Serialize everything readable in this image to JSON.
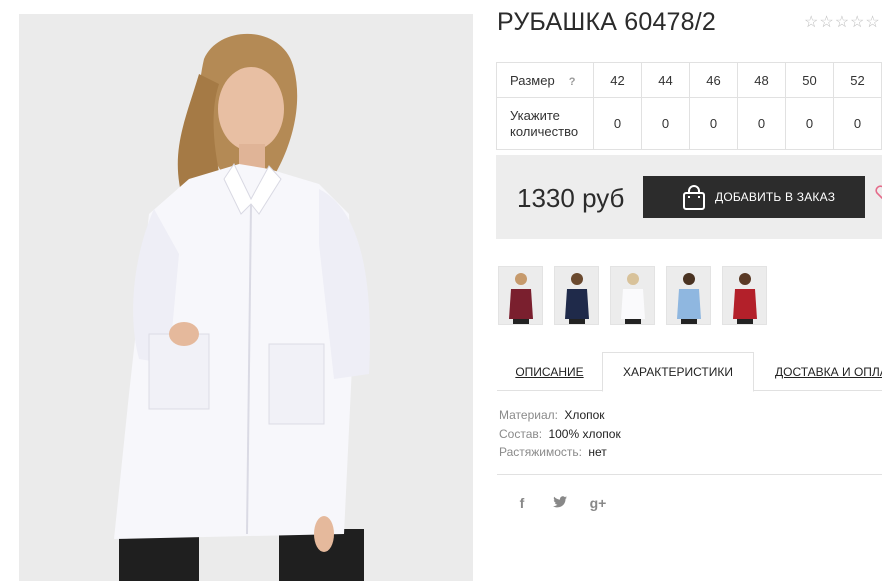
{
  "product": {
    "title": "РУБАШКА 60478/2",
    "rating_stars": 5
  },
  "size_table": {
    "size_label": "Размер",
    "help_label": "?",
    "sizes": [
      "42",
      "44",
      "46",
      "48",
      "50",
      "52"
    ],
    "quantity_label": "Укажите количество",
    "quantities": [
      "0",
      "0",
      "0",
      "0",
      "0",
      "0"
    ]
  },
  "purchase": {
    "price": "1330 руб",
    "add_button_label": "ДОБАВИТЬ В ЗАКАЗ"
  },
  "thumbnails": [
    {
      "color": "#7a1f2e",
      "name": "burgundy"
    },
    {
      "color": "#1f2a4a",
      "name": "navy"
    },
    {
      "color": "#f4f4f6",
      "name": "white"
    },
    {
      "color": "#8fb7e0",
      "name": "light-blue"
    },
    {
      "color": "#b3202a",
      "name": "red"
    }
  ],
  "tabs": {
    "description": "ОПИСАНИЕ",
    "characteristics": "ХАРАКТЕРИСТИКИ",
    "delivery": "ДОСТАВКА И ОПЛАТА"
  },
  "specs": [
    {
      "key": "Материал:",
      "value": "Хлопок"
    },
    {
      "key": "Состав:",
      "value": "100% хлопок"
    },
    {
      "key": "Растяжимость:",
      "value": "нет"
    }
  ],
  "social": {
    "facebook": "f",
    "twitter": "🐦",
    "googleplus": "g+"
  },
  "colors": {
    "button_bg": "#2c2c2c",
    "price_box_bg": "#ededed",
    "border": "#e1e1e1"
  }
}
